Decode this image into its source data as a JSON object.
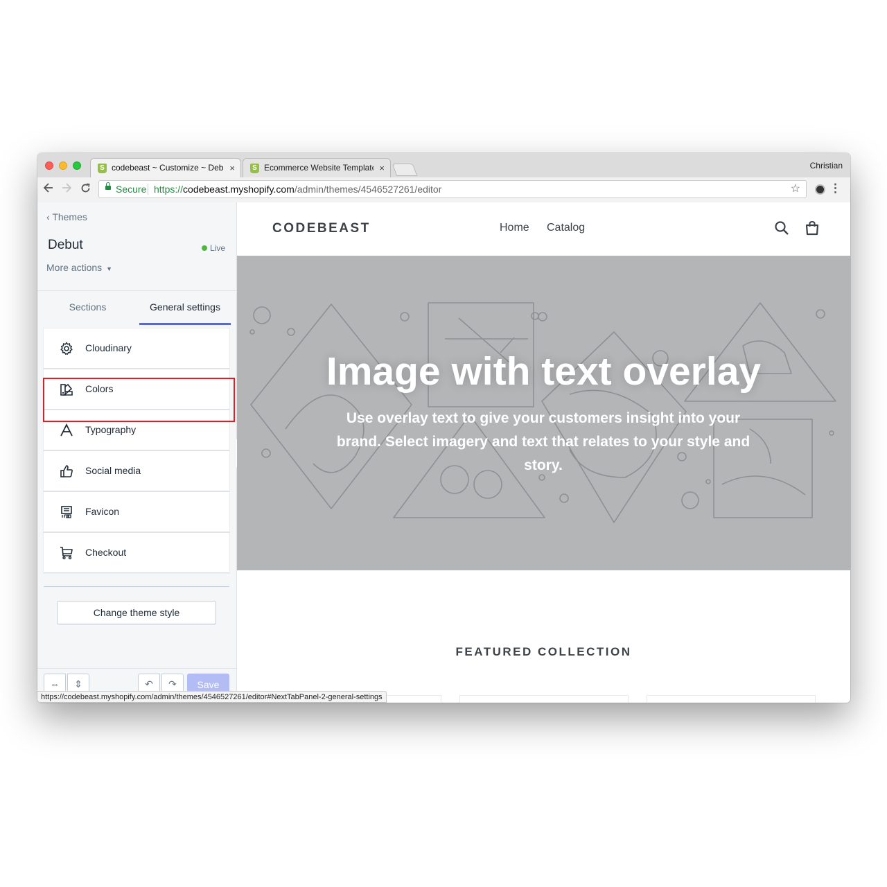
{
  "browser": {
    "tabs": [
      {
        "title": "codebeast ~ Customize ~ Debut",
        "active": true
      },
      {
        "title": "Ecommerce Website Templates",
        "active": false
      }
    ],
    "favicon_glyph": "S",
    "close_glyph": "×",
    "profile_name": "Christian",
    "secure_label": "Secure",
    "url": {
      "scheme": "https://",
      "host": "codebeast.myshopify.com",
      "path": "/admin/themes/4546527261/editor"
    },
    "status_url": "https://codebeast.myshopify.com/admin/themes/4546527261/editor#NextTabPanel-2-general-settings",
    "icons": {
      "back": "‹",
      "forward": "›",
      "reload": "↻",
      "star": "☆",
      "menu": "⋮"
    }
  },
  "sidebar": {
    "back_link": "Themes",
    "back_glyph": "‹",
    "theme_name": "Debut",
    "live_label": "Live",
    "more_actions": "More actions",
    "caret_glyph": "▼",
    "tabs": [
      {
        "label": "Sections",
        "active": false
      },
      {
        "label": "General settings",
        "active": true
      }
    ],
    "settings_items": [
      {
        "label": "Cloudinary",
        "icon": "gear-icon",
        "glyph": "⚙",
        "highlighted": true
      },
      {
        "label": "Colors",
        "icon": "colors-icon",
        "glyph": "▚"
      },
      {
        "label": "Typography",
        "icon": "typography-icon",
        "glyph": "A"
      },
      {
        "label": "Social media",
        "icon": "thumbs-up-icon",
        "glyph": "👍"
      },
      {
        "label": "Favicon",
        "icon": "favicon-icon",
        "glyph": "▤"
      },
      {
        "label": "Checkout",
        "icon": "cart-icon",
        "glyph": "🛒"
      }
    ],
    "change_theme_style": "Change theme style",
    "save_label": "Save",
    "bottom_icons": {
      "mobile": "⇔",
      "desktop": "⇕",
      "undo": "↶",
      "redo": "↷"
    },
    "collapse_glyph": "◂"
  },
  "store": {
    "logo": "CODEBEAST",
    "nav": [
      "Home",
      "Catalog"
    ],
    "hero_title": "Image with text overlay",
    "hero_text": "Use overlay text to give your customers insight into your brand. Select imagery and text that relates to your style and story.",
    "featured_heading": "FEATURED COLLECTION",
    "colors": {
      "hero_bg": "#b4b5b7",
      "line_art": "#8f9094",
      "accent": "#5c6ac4",
      "highlight": "#e01e26",
      "live": "#50b83c"
    }
  }
}
